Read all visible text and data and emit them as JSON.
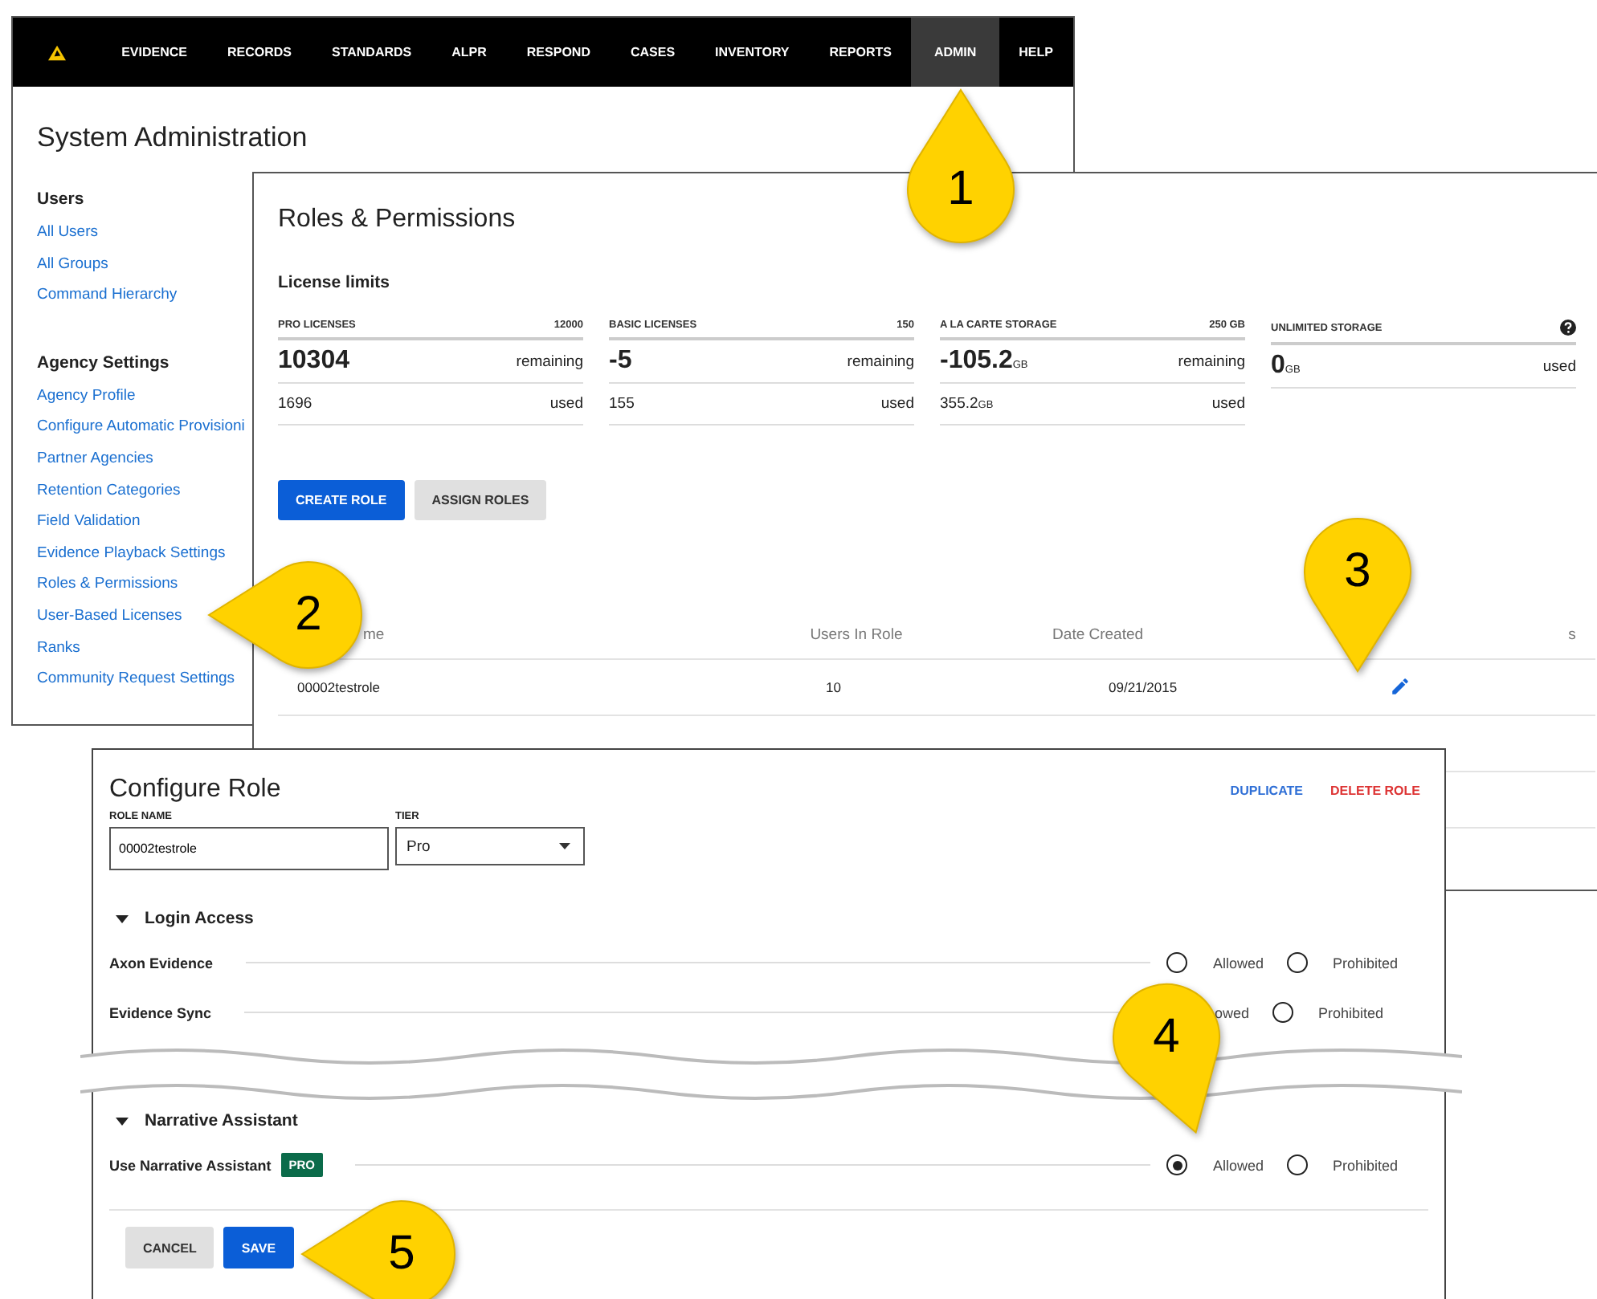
{
  "nav": {
    "items": [
      {
        "label": "EVIDENCE",
        "selected": false
      },
      {
        "label": "RECORDS",
        "selected": false
      },
      {
        "label": "STANDARDS",
        "selected": false
      },
      {
        "label": "ALPR",
        "selected": false
      },
      {
        "label": "RESPOND",
        "selected": false
      },
      {
        "label": "CASES",
        "selected": false
      },
      {
        "label": "INVENTORY",
        "selected": false
      },
      {
        "label": "REPORTS",
        "selected": false
      },
      {
        "label": "ADMIN",
        "selected": true
      },
      {
        "label": "HELP",
        "selected": false
      }
    ]
  },
  "admin_page": {
    "title": "System Administration",
    "sections": [
      {
        "heading": "Users",
        "links": [
          "All Users",
          "All Groups",
          "Command Hierarchy"
        ]
      },
      {
        "heading": "Agency Settings",
        "links": [
          "Agency Profile",
          "Configure Automatic Provisioni",
          "Partner Agencies",
          "Retention Categories",
          "Field Validation",
          "Evidence Playback Settings",
          "Roles & Permissions",
          "User-Based Licenses",
          "Ranks",
          "Community Request Settings"
        ]
      }
    ]
  },
  "roles_page": {
    "title": "Roles & Permissions",
    "license_heading": "License limits",
    "licenses": [
      {
        "kind": "metered",
        "name": "PRO LICENSES",
        "limit": "12000",
        "value": "10304",
        "value_label": "remaining",
        "used": "1696",
        "used_label": "used"
      },
      {
        "kind": "metered",
        "name": "BASIC LICENSES",
        "limit": "150",
        "value": "-5",
        "value_label": "remaining",
        "used": "155",
        "used_label": "used"
      },
      {
        "kind": "metered",
        "name": "A LA CARTE STORAGE",
        "limit": "250 GB",
        "value": "-105.2",
        "unit": "GB",
        "value_label": "remaining",
        "used": "355.2",
        "used_unit": "GB",
        "used_label": "used"
      },
      {
        "kind": "unlimited",
        "name": "UNLIMITED STORAGE",
        "value": "0",
        "unit": "GB",
        "value_label": "used"
      }
    ],
    "buttons": [
      {
        "label": "CREATE ROLE",
        "kind": "primary"
      },
      {
        "label": "ASSIGN ROLES",
        "kind": "secondary"
      }
    ],
    "table": {
      "columns": [
        "me",
        "Users In Role",
        "Date Created",
        "s"
      ],
      "rows": [
        {
          "cells": [
            "00002testrole",
            "10",
            "09/21/2015"
          ]
        }
      ]
    }
  },
  "configure_role": {
    "title": "Configure Role",
    "actions": [
      {
        "label": "DUPLICATE",
        "kind": "primary"
      },
      {
        "label": "DELETE ROLE",
        "kind": "danger"
      }
    ],
    "role_name": {
      "label": "ROLE NAME",
      "value": "00002testrole"
    },
    "tier": {
      "label": "TIER",
      "value": "Pro"
    },
    "sections": [
      {
        "title": "Login Access",
        "expanded": true,
        "permissions": [
          {
            "name": "Axon Evidence",
            "options": [
              {
                "label": "Allowed",
                "selected": false
              },
              {
                "label": "Prohibited",
                "selected": false
              }
            ]
          },
          {
            "name": "Evidence Sync",
            "options": [
              {
                "label": "owed"
              },
              {
                "label": "Prohibited",
                "selected": false
              }
            ]
          }
        ]
      },
      {
        "title": "Narrative Assistant",
        "expanded": true,
        "permissions": [
          {
            "name": "Use Narrative Assistant",
            "badge": "PRO",
            "options": [
              {
                "label": "Allowed",
                "selected": true
              },
              {
                "label": "Prohibited",
                "selected": false
              }
            ]
          }
        ]
      }
    ],
    "footer_buttons": [
      {
        "label": "CANCEL",
        "kind": "secondary"
      },
      {
        "label": "SAVE",
        "kind": "primary"
      }
    ]
  },
  "callouts": [
    {
      "label": "1"
    },
    {
      "label": "2"
    },
    {
      "label": "3"
    },
    {
      "label": "4"
    },
    {
      "label": "5"
    }
  ]
}
